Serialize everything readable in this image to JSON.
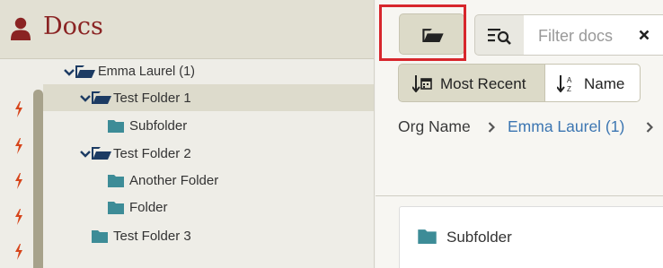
{
  "header": {
    "title": "Docs",
    "icon": "user-icon"
  },
  "tree": {
    "items": [
      {
        "label": "Emma Laurel (1)",
        "expanded": true,
        "selected": false
      },
      {
        "label": "Test Folder 1",
        "expanded": true,
        "selected": true
      },
      {
        "label": "Subfolder",
        "expanded": false,
        "selected": false
      },
      {
        "label": "Test Folder 2",
        "expanded": true,
        "selected": false
      },
      {
        "label": "Another Folder",
        "expanded": false,
        "selected": false
      },
      {
        "label": "Folder",
        "expanded": false,
        "selected": false
      },
      {
        "label": "Test Folder 3",
        "expanded": false,
        "selected": false
      }
    ]
  },
  "toolbar": {
    "folder_button_icon": "folder-open-icon",
    "filter_icon": "filter-search-icon",
    "filter_placeholder": "Filter docs",
    "clear_icon": "close-icon"
  },
  "sort": {
    "most_recent_label": "Most Recent",
    "name_label": "Name",
    "active": "Most Recent"
  },
  "breadcrumb": {
    "items": [
      "Org Name",
      "Emma Laurel (1)"
    ]
  },
  "content": {
    "items": [
      {
        "label": "Subfolder"
      }
    ]
  },
  "colors": {
    "brand": "#8a2323",
    "folder_open": "#1c3b63",
    "folder_closed": "#3d8c97",
    "link": "#3c76b2",
    "highlight": "#d7262c",
    "bolt": "#d6451b"
  }
}
